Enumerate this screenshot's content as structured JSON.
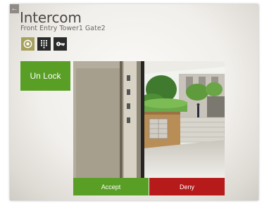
{
  "header": {
    "back_glyph": "←",
    "title": "Intercom",
    "subtitle": "Front Entry  Tower1 Gate2"
  },
  "toolbar": {
    "buttons": [
      {
        "icon": "video-camera-icon",
        "active": true
      },
      {
        "icon": "keypad-icon",
        "active": false
      },
      {
        "icon": "key-icon",
        "active": false
      }
    ]
  },
  "actions": {
    "unlock_label": "Un Lock",
    "accept_label": "Accept",
    "deny_label": "Deny"
  },
  "colors": {
    "green": "#5a9f25",
    "red": "#b61a1a",
    "active_tab": "#a6a05d",
    "title_text": "#4b4846"
  }
}
